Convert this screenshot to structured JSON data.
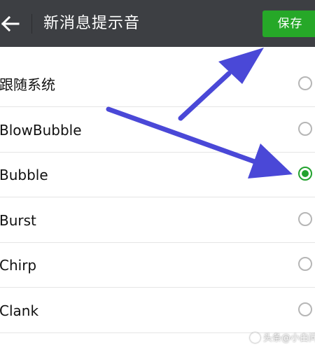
{
  "header": {
    "title": "新消息提示音",
    "save_label": "保存",
    "back_icon": "back-arrow-icon",
    "background_color": "#3d3f43",
    "save_color": "#26a828"
  },
  "list": {
    "items": [
      {
        "label": "跟随系统",
        "selected": false
      },
      {
        "label": "BlowBubble",
        "selected": false
      },
      {
        "label": "Bubble",
        "selected": true
      },
      {
        "label": "Burst",
        "selected": false
      },
      {
        "label": "Chirp",
        "selected": false
      },
      {
        "label": "Clank",
        "selected": false
      }
    ],
    "selected_color": "#22a22e",
    "unselected_color": "#b6b6b6"
  },
  "annotations": {
    "arrow_color": "#4a48d7",
    "arrow_targets": [
      "save-button",
      "radio-bubble"
    ]
  },
  "watermark": {
    "text": "头条@小白问答"
  }
}
